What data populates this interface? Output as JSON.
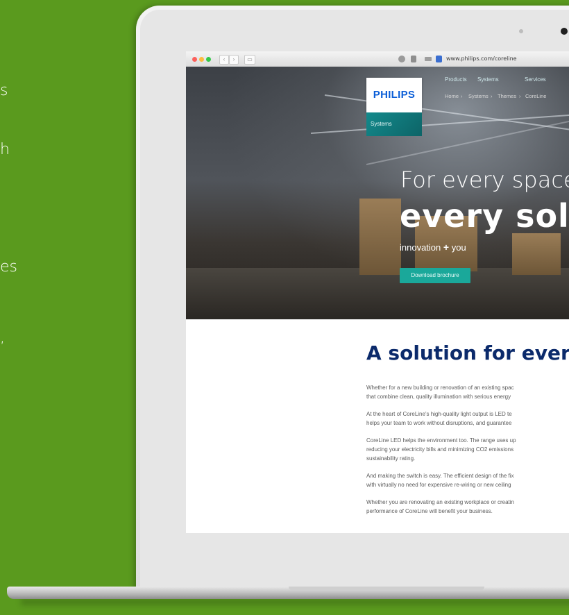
{
  "background": {
    "color": "#5a9a1e",
    "fragments": [
      "s",
      "h",
      "es",
      ","
    ]
  },
  "browser": {
    "url": "www.philips.com/coreline",
    "back_icon": "chevron-left-icon",
    "forward_icon": "chevron-right-icon"
  },
  "site": {
    "logo": "PHILIPS",
    "section_tab": "Systems",
    "nav": [
      "Products",
      "Systems",
      "Services"
    ],
    "breadcrumb": [
      "Home",
      "Systems",
      "Themes",
      "CoreLine"
    ]
  },
  "hero": {
    "line1": "For every space",
    "line2": "every solu",
    "tagline_pre": "innovation",
    "tagline_plus": "+",
    "tagline_post": "you",
    "cta": "Download brochure"
  },
  "content": {
    "title": "A solution for ever",
    "paragraphs": [
      "Whether for a new building or renovation of an existing spac",
      "that combine clean, quality illumination with serious energy",
      "At the heart of CoreLine's high-quality light output is LED te",
      "helps your team to work without disruptions, and guarantee",
      "CoreLine LED helps the environment too. The range uses up",
      "reducing your electricity bills and minimizing CO2 emissions",
      "sustainability rating.",
      "And making the switch is easy. The efficient design of the fix",
      "with virtually no need for expensive re-wiring or new ceiling",
      "Whether you are renovating an existing workplace or creatin",
      "performance of CoreLine will benefit your business."
    ]
  },
  "colors": {
    "brand_blue": "#0b5ed7",
    "teal": "#1aa89a",
    "heading": "#0b2a6b"
  }
}
